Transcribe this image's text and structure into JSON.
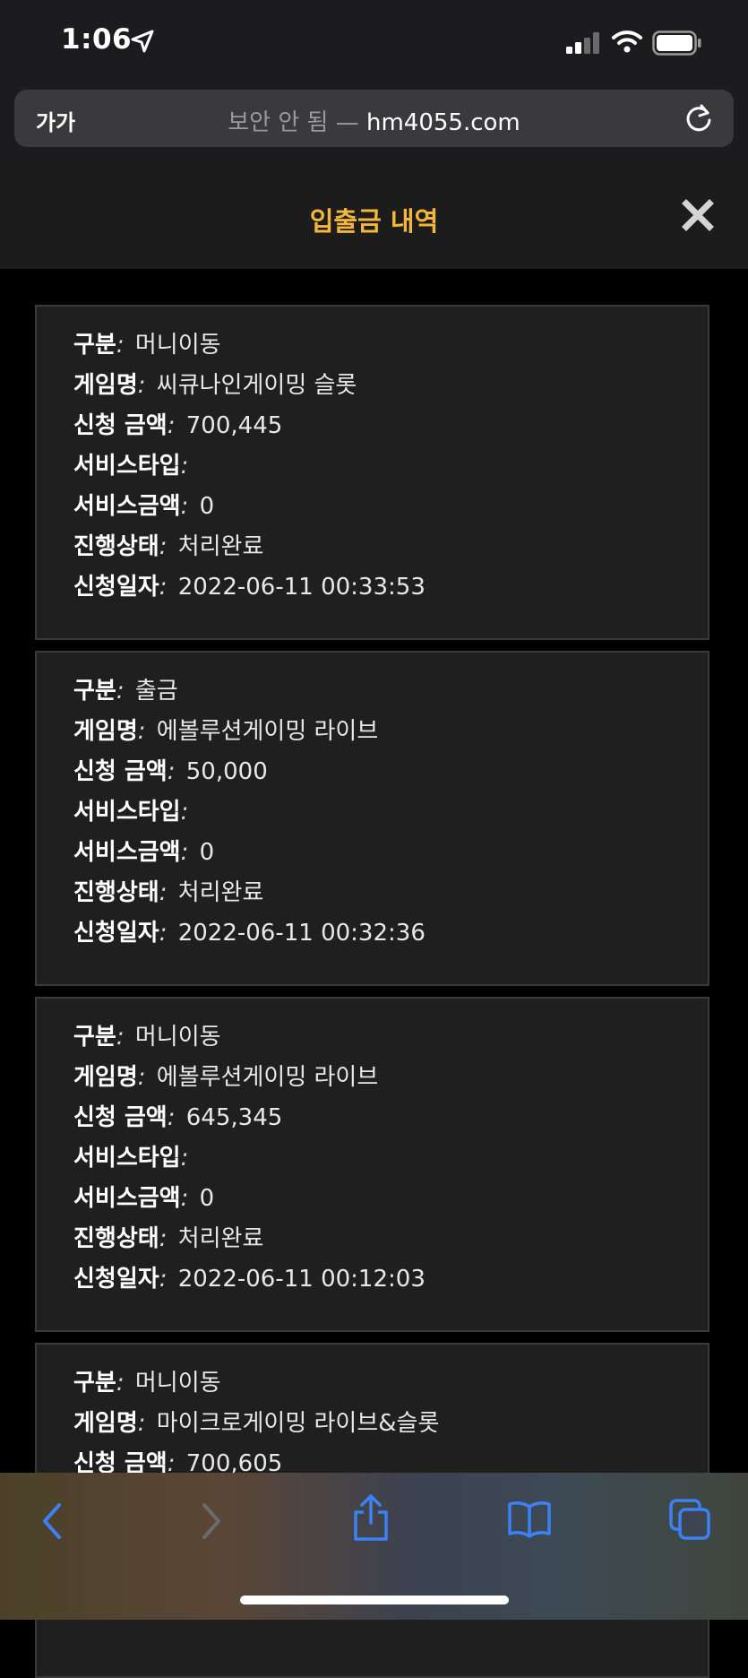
{
  "status_bar": {
    "time": "1:06"
  },
  "browser": {
    "text_size_label": "가가",
    "security_text": "보안 안 됨",
    "separator": "—",
    "domain": "hm4055.com"
  },
  "header": {
    "title": "입출금 내역"
  },
  "labels": {
    "category": "구분",
    "game_name": "게임명",
    "request_amount": "신청 금액",
    "service_type": "서비스타입",
    "service_amount": "서비스금액",
    "status": "진행상태",
    "request_date": "신청일자",
    "colon": ":"
  },
  "records": [
    {
      "category": "머니이동",
      "game_name": "씨큐나인게이밍 슬롯",
      "request_amount": "700,445",
      "service_type": "",
      "service_amount": "0",
      "status": "처리완료",
      "request_date": "2022-06-11 00:33:53"
    },
    {
      "category": "출금",
      "game_name": "에볼루션게이밍 라이브",
      "request_amount": "50,000",
      "service_type": "",
      "service_amount": "0",
      "status": "처리완료",
      "request_date": "2022-06-11 00:32:36"
    },
    {
      "category": "머니이동",
      "game_name": "에볼루션게이밍 라이브",
      "request_amount": "645,345",
      "service_type": "",
      "service_amount": "0",
      "status": "처리완료",
      "request_date": "2022-06-11 00:12:03"
    },
    {
      "category": "머니이동",
      "game_name": "마이크로게이밍 라이브&슬롯",
      "request_amount": "700,605",
      "service_type": "",
      "service_amount": "",
      "status": "",
      "request_date": ""
    }
  ],
  "colors": {
    "title_accent": "#f4b63b",
    "card_bg": "#1f1f1f",
    "link_blue": "#3b82f6"
  },
  "icons": {
    "location": "location-arrow-icon",
    "signal": "cellular-signal-icon",
    "wifi": "wifi-icon",
    "battery": "battery-icon",
    "reload": "reload-icon",
    "close": "close-icon",
    "back": "back-chevron-icon",
    "forward": "forward-chevron-icon",
    "share": "share-icon",
    "bookmarks": "bookmarks-book-icon",
    "tabs": "tabs-icon"
  }
}
